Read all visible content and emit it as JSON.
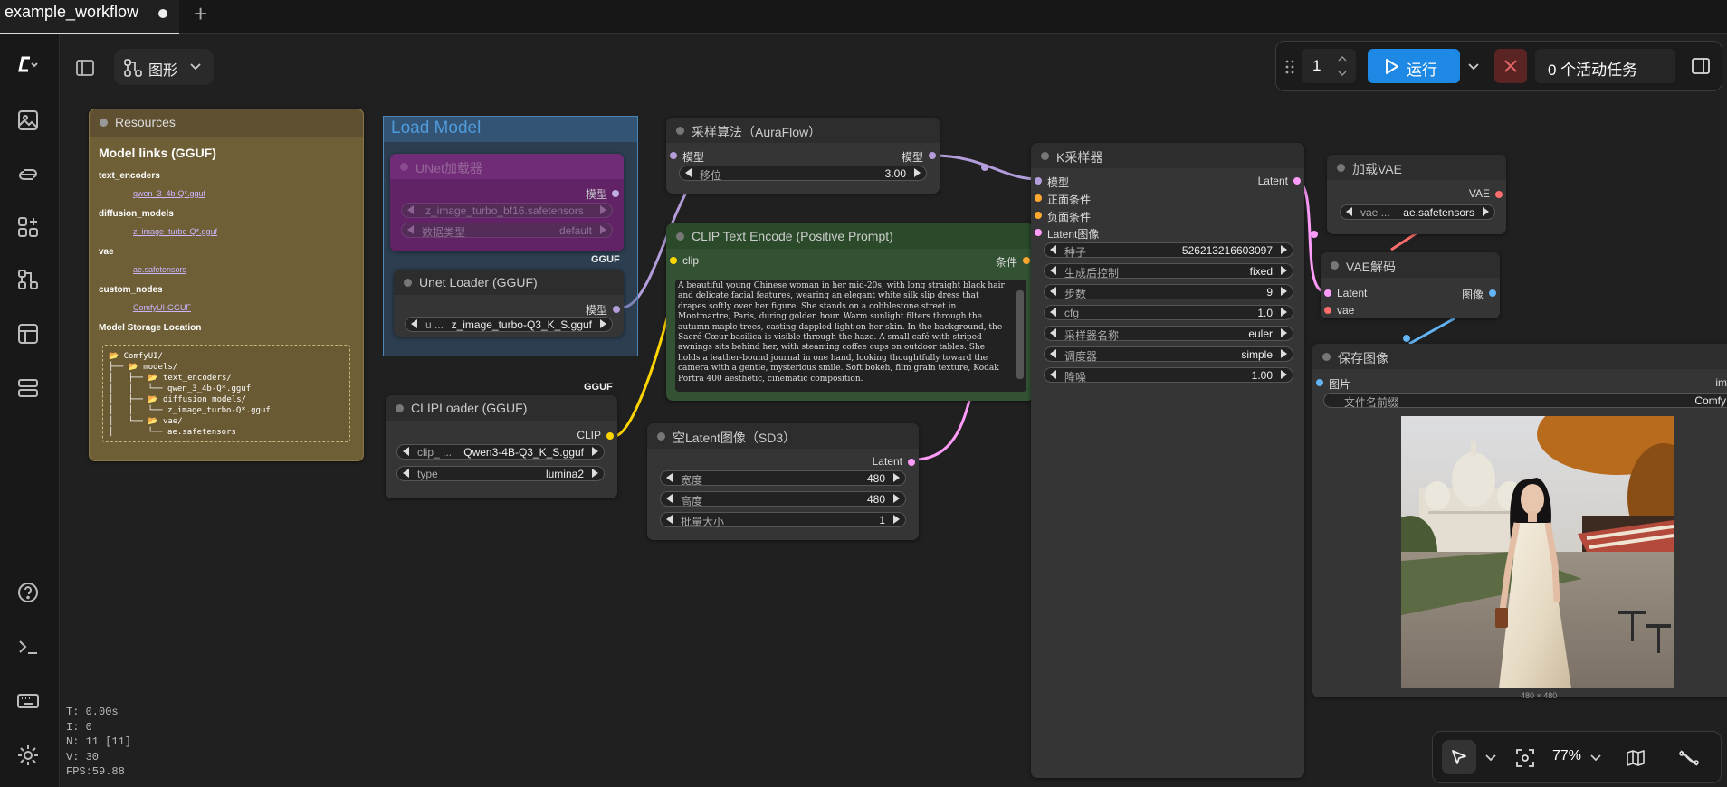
{
  "tab": {
    "title": "example_workflow",
    "add": "+"
  },
  "toolbar": {
    "view_label": "图形",
    "queue_count": "1",
    "run_label": "运行",
    "active_tasks": "0 个活动任务"
  },
  "zoom": {
    "value": "77%"
  },
  "stats": {
    "t": "T: 0.00s",
    "i": "I: 0",
    "n": "N: 11 [11]",
    "v": "V: 30",
    "fps": "FPS:59.88"
  },
  "resources": {
    "title": "Resources",
    "heading": "Model links (GGUF)",
    "text_encoders_label": "text_encoders",
    "text_encoders_link": "qwen_3_4b-Q*.gguf",
    "diffusion_label": "diffusion_models",
    "diffusion_link": "z_image_turbo-Q*.gguf",
    "vae_label": "vae",
    "vae_link": "ae.safetensors",
    "custom_label": "custom_nodes",
    "custom_link": "ComfyUI-GGUF",
    "storage_label": "Model Storage Location",
    "tree": [
      "📂 ComfyUI/",
      "├── 📂 models/",
      "│   ├── 📂 text_encoders/",
      "│   │   └── qwen_3_4b-Q*.gguf",
      "│   ├── 📂 diffusion_models/",
      "│   │   └── z_image_turbo-Q*.gguf",
      "│   └── 📂 vae/",
      "│       └── ae.safetensors"
    ]
  },
  "group_load": {
    "title": "Load Model"
  },
  "unet_bypass": {
    "title": "UNet加载器",
    "out": "模型",
    "w1": "z_image_turbo_bf16.safetensors",
    "w2_l": "数据类型",
    "w2_r": "default"
  },
  "gguf_tag1": "GGUF",
  "gguf_tag2": "GGUF",
  "unet_gguf": {
    "title": "Unet Loader (GGUF)",
    "out": "模型",
    "w_l": "u ...",
    "w_r": "z_image_turbo-Q3_K_S.gguf"
  },
  "clip_loader": {
    "title": "CLIPLoader (GGUF)",
    "out": "CLIP",
    "w1_l": "clip_ ...",
    "w1_r": "Qwen3-4B-Q3_K_S.gguf",
    "w2_l": "type",
    "w2_r": "lumina2"
  },
  "sampling": {
    "title": "采样算法（AuraFlow）",
    "in": "模型",
    "out": "模型",
    "w_l": "移位",
    "w_r": "3.00"
  },
  "clip_text": {
    "title": "CLIP Text Encode (Positive Prompt)",
    "in": "clip",
    "out": "条件",
    "prompt": "A beautiful young Chinese woman in her mid-20s, with long straight black hair and delicate facial features, wearing an elegant white silk slip dress that drapes softly over her figure. She stands on a cobblestone street in Montmartre, Paris, during golden hour. Warm sunlight filters through the autumn maple trees, casting dappled light on her skin. In the background, the Sacré-Cœur basilica is visible through the haze. A small café with striped awnings sits behind her, with steaming coffee cups on outdoor tables. She holds a leather-bound journal in one hand, looking thoughtfully toward the camera with a gentle, mysterious smile. Soft bokeh, film grain texture, Kodak Portra 400 aesthetic, cinematic composition."
  },
  "empty_latent": {
    "title": "空Latent图像（SD3）",
    "out": "Latent",
    "w1_l": "宽度",
    "w1_r": "480",
    "w2_l": "高度",
    "w2_r": "480",
    "w3_l": "批量大小",
    "w3_r": "1"
  },
  "ksampler": {
    "title": "K采样器",
    "in1": "模型",
    "in2": "正面条件",
    "in3": "负面条件",
    "in4": "Latent图像",
    "out": "Latent",
    "seed_l": "种子",
    "seed_r": "526213216603097",
    "ctrl_l": "生成后控制",
    "ctrl_r": "fixed",
    "steps_l": "步数",
    "steps_r": "9",
    "cfg_l": "cfg",
    "cfg_r": "1.0",
    "sampler_l": "采样器名称",
    "sampler_r": "euler",
    "sched_l": "调度器",
    "sched_r": "simple",
    "denoise_l": "降噪",
    "denoise_r": "1.00"
  },
  "load_vae": {
    "title": "加载VAE",
    "out": "VAE",
    "w_l": "vae ...",
    "w_r": "ae.safetensors"
  },
  "vae_decode": {
    "title": "VAE解码",
    "in1": "Latent",
    "in2": "vae",
    "out": "图像"
  },
  "save_image": {
    "title": "保存图像",
    "in": "图片",
    "out": "im",
    "w_l": "文件名前缀",
    "w_r": "Comfy",
    "caption": "480 × 480"
  },
  "colors": {
    "model": "#b39ddb",
    "clip": "#ffd500",
    "cond": "#ffa931",
    "latent": "#ff9cf9",
    "vae": "#ff6e6e",
    "image": "#64b5f6",
    "run": "#1e88e5"
  }
}
